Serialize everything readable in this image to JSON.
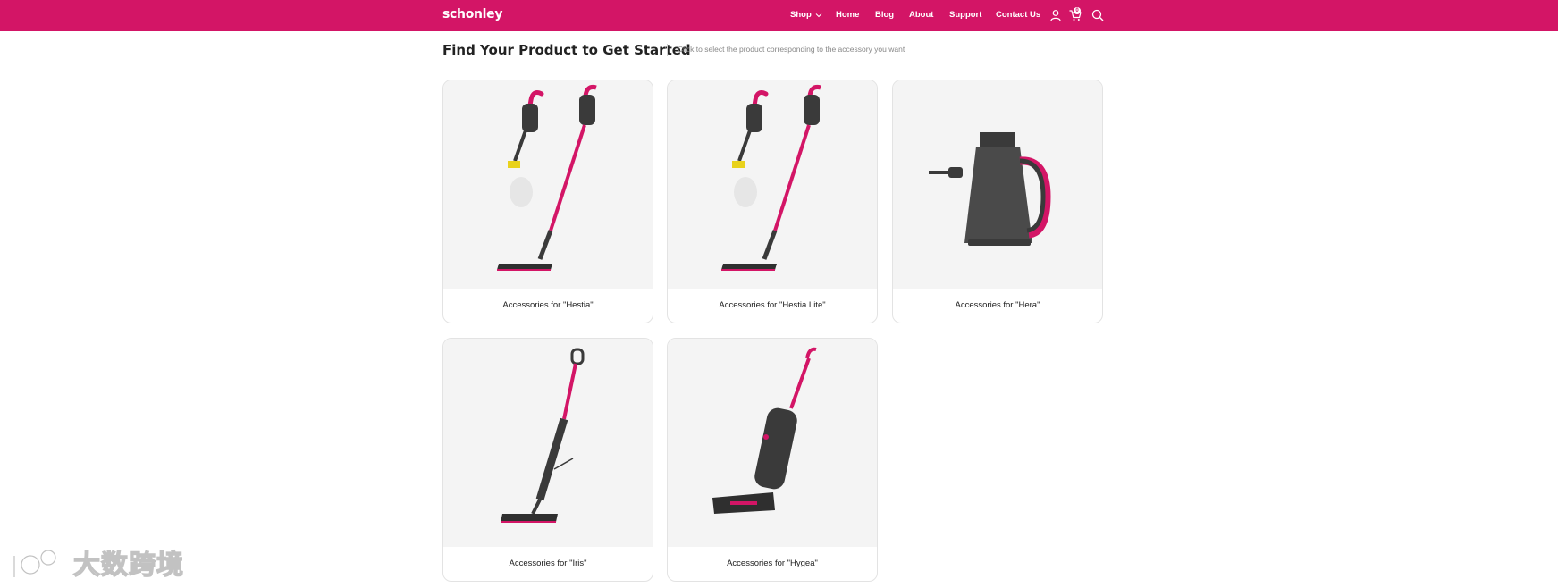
{
  "header": {
    "logo": "schonley",
    "nav": [
      "Shop",
      "Home",
      "Blog",
      "About",
      "Support",
      "Contact Us"
    ],
    "cart_count": "0"
  },
  "main": {
    "title": "Find Your Product to Get Started",
    "subtitle": "Click to select the product corresponding to the accessory you want",
    "products": [
      {
        "label": "Accessories for \"Hestia\""
      },
      {
        "label": "Accessories for \"Hestia Lite\""
      },
      {
        "label": "Accessories for \"Hera\""
      },
      {
        "label": "Accessories for \"Iris\""
      },
      {
        "label": "Accessories for \"Hygea\""
      }
    ]
  },
  "watermark": {
    "text": "大数跨境"
  },
  "colors": {
    "brand": "#d31566",
    "card_bg": "#f4f4f4"
  },
  "icons": [
    "user-icon",
    "cart-icon",
    "search-icon",
    "chevron-down-icon"
  ]
}
